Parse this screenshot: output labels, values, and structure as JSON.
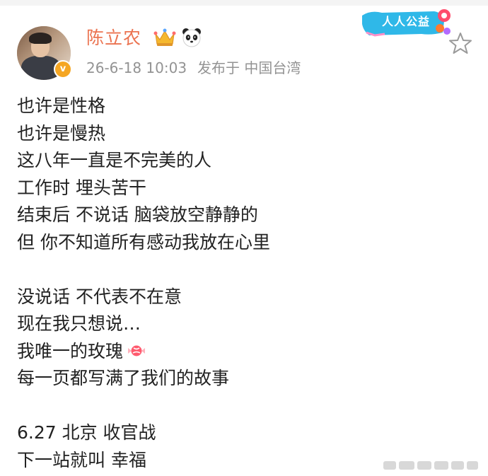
{
  "user": {
    "name": "陈立农",
    "verified_mark": "v"
  },
  "post": {
    "date": "26-6-18 10:03",
    "source": "发布于 中国台湾",
    "lines": [
      "也许是性格",
      "也许是慢热",
      "这八年一直是不完美的人",
      "工作时 埋头苦干",
      "结束后 不说话 脑袋放空静静的",
      "但 你不知道所有感动我放在心里",
      "",
      "没说话 不代表不在意",
      "现在我只想说…",
      "我唯一的玫瑰",
      "每一页都写满了我们的故事",
      "",
      "6.27 北京 收官战",
      "下一站就叫 幸福"
    ]
  },
  "badge": {
    "label": "人人公益"
  },
  "icons": {
    "crown": "crown-icon",
    "panda": "panda-icon",
    "star": "star-icon",
    "candy": "candy-icon"
  },
  "colors": {
    "username": "#eb7350",
    "meta": "#939393",
    "verified": "#f5a623",
    "badge": "#2fb8e8"
  }
}
